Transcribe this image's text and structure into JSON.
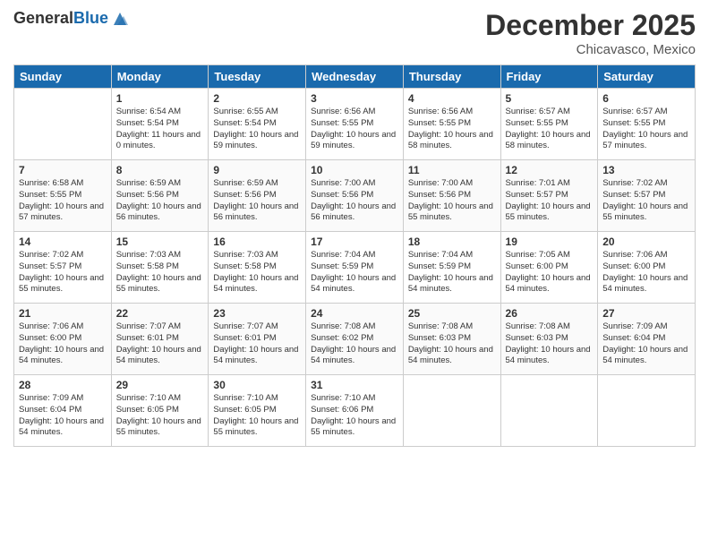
{
  "header": {
    "logo": {
      "general": "General",
      "blue": "Blue"
    },
    "title": "December 2025",
    "location": "Chicavasco, Mexico"
  },
  "weekdays": [
    "Sunday",
    "Monday",
    "Tuesday",
    "Wednesday",
    "Thursday",
    "Friday",
    "Saturday"
  ],
  "weeks": [
    [
      {
        "day": "",
        "sunrise": "",
        "sunset": "",
        "daylight": ""
      },
      {
        "day": "1",
        "sunrise": "Sunrise: 6:54 AM",
        "sunset": "Sunset: 5:54 PM",
        "daylight": "Daylight: 11 hours and 0 minutes."
      },
      {
        "day": "2",
        "sunrise": "Sunrise: 6:55 AM",
        "sunset": "Sunset: 5:54 PM",
        "daylight": "Daylight: 10 hours and 59 minutes."
      },
      {
        "day": "3",
        "sunrise": "Sunrise: 6:56 AM",
        "sunset": "Sunset: 5:55 PM",
        "daylight": "Daylight: 10 hours and 59 minutes."
      },
      {
        "day": "4",
        "sunrise": "Sunrise: 6:56 AM",
        "sunset": "Sunset: 5:55 PM",
        "daylight": "Daylight: 10 hours and 58 minutes."
      },
      {
        "day": "5",
        "sunrise": "Sunrise: 6:57 AM",
        "sunset": "Sunset: 5:55 PM",
        "daylight": "Daylight: 10 hours and 58 minutes."
      },
      {
        "day": "6",
        "sunrise": "Sunrise: 6:57 AM",
        "sunset": "Sunset: 5:55 PM",
        "daylight": "Daylight: 10 hours and 57 minutes."
      }
    ],
    [
      {
        "day": "7",
        "sunrise": "Sunrise: 6:58 AM",
        "sunset": "Sunset: 5:55 PM",
        "daylight": "Daylight: 10 hours and 57 minutes."
      },
      {
        "day": "8",
        "sunrise": "Sunrise: 6:59 AM",
        "sunset": "Sunset: 5:56 PM",
        "daylight": "Daylight: 10 hours and 56 minutes."
      },
      {
        "day": "9",
        "sunrise": "Sunrise: 6:59 AM",
        "sunset": "Sunset: 5:56 PM",
        "daylight": "Daylight: 10 hours and 56 minutes."
      },
      {
        "day": "10",
        "sunrise": "Sunrise: 7:00 AM",
        "sunset": "Sunset: 5:56 PM",
        "daylight": "Daylight: 10 hours and 56 minutes."
      },
      {
        "day": "11",
        "sunrise": "Sunrise: 7:00 AM",
        "sunset": "Sunset: 5:56 PM",
        "daylight": "Daylight: 10 hours and 55 minutes."
      },
      {
        "day": "12",
        "sunrise": "Sunrise: 7:01 AM",
        "sunset": "Sunset: 5:57 PM",
        "daylight": "Daylight: 10 hours and 55 minutes."
      },
      {
        "day": "13",
        "sunrise": "Sunrise: 7:02 AM",
        "sunset": "Sunset: 5:57 PM",
        "daylight": "Daylight: 10 hours and 55 minutes."
      }
    ],
    [
      {
        "day": "14",
        "sunrise": "Sunrise: 7:02 AM",
        "sunset": "Sunset: 5:57 PM",
        "daylight": "Daylight: 10 hours and 55 minutes."
      },
      {
        "day": "15",
        "sunrise": "Sunrise: 7:03 AM",
        "sunset": "Sunset: 5:58 PM",
        "daylight": "Daylight: 10 hours and 55 minutes."
      },
      {
        "day": "16",
        "sunrise": "Sunrise: 7:03 AM",
        "sunset": "Sunset: 5:58 PM",
        "daylight": "Daylight: 10 hours and 54 minutes."
      },
      {
        "day": "17",
        "sunrise": "Sunrise: 7:04 AM",
        "sunset": "Sunset: 5:59 PM",
        "daylight": "Daylight: 10 hours and 54 minutes."
      },
      {
        "day": "18",
        "sunrise": "Sunrise: 7:04 AM",
        "sunset": "Sunset: 5:59 PM",
        "daylight": "Daylight: 10 hours and 54 minutes."
      },
      {
        "day": "19",
        "sunrise": "Sunrise: 7:05 AM",
        "sunset": "Sunset: 6:00 PM",
        "daylight": "Daylight: 10 hours and 54 minutes."
      },
      {
        "day": "20",
        "sunrise": "Sunrise: 7:06 AM",
        "sunset": "Sunset: 6:00 PM",
        "daylight": "Daylight: 10 hours and 54 minutes."
      }
    ],
    [
      {
        "day": "21",
        "sunrise": "Sunrise: 7:06 AM",
        "sunset": "Sunset: 6:00 PM",
        "daylight": "Daylight: 10 hours and 54 minutes."
      },
      {
        "day": "22",
        "sunrise": "Sunrise: 7:07 AM",
        "sunset": "Sunset: 6:01 PM",
        "daylight": "Daylight: 10 hours and 54 minutes."
      },
      {
        "day": "23",
        "sunrise": "Sunrise: 7:07 AM",
        "sunset": "Sunset: 6:01 PM",
        "daylight": "Daylight: 10 hours and 54 minutes."
      },
      {
        "day": "24",
        "sunrise": "Sunrise: 7:08 AM",
        "sunset": "Sunset: 6:02 PM",
        "daylight": "Daylight: 10 hours and 54 minutes."
      },
      {
        "day": "25",
        "sunrise": "Sunrise: 7:08 AM",
        "sunset": "Sunset: 6:03 PM",
        "daylight": "Daylight: 10 hours and 54 minutes."
      },
      {
        "day": "26",
        "sunrise": "Sunrise: 7:08 AM",
        "sunset": "Sunset: 6:03 PM",
        "daylight": "Daylight: 10 hours and 54 minutes."
      },
      {
        "day": "27",
        "sunrise": "Sunrise: 7:09 AM",
        "sunset": "Sunset: 6:04 PM",
        "daylight": "Daylight: 10 hours and 54 minutes."
      }
    ],
    [
      {
        "day": "28",
        "sunrise": "Sunrise: 7:09 AM",
        "sunset": "Sunset: 6:04 PM",
        "daylight": "Daylight: 10 hours and 54 minutes."
      },
      {
        "day": "29",
        "sunrise": "Sunrise: 7:10 AM",
        "sunset": "Sunset: 6:05 PM",
        "daylight": "Daylight: 10 hours and 55 minutes."
      },
      {
        "day": "30",
        "sunrise": "Sunrise: 7:10 AM",
        "sunset": "Sunset: 6:05 PM",
        "daylight": "Daylight: 10 hours and 55 minutes."
      },
      {
        "day": "31",
        "sunrise": "Sunrise: 7:10 AM",
        "sunset": "Sunset: 6:06 PM",
        "daylight": "Daylight: 10 hours and 55 minutes."
      },
      {
        "day": "",
        "sunrise": "",
        "sunset": "",
        "daylight": ""
      },
      {
        "day": "",
        "sunrise": "",
        "sunset": "",
        "daylight": ""
      },
      {
        "day": "",
        "sunrise": "",
        "sunset": "",
        "daylight": ""
      }
    ]
  ]
}
